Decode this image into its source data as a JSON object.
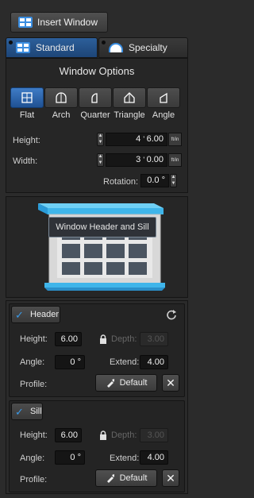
{
  "insert_window": {
    "label": "Insert Window",
    "icon": "window-icon"
  },
  "tabs": [
    {
      "label": "Standard",
      "icon": "window-icon",
      "active": true
    },
    {
      "label": "Specialty",
      "icon": "arch-window-icon",
      "active": false
    }
  ],
  "window_options": {
    "title": "Window Options",
    "shapes": [
      {
        "label": "Flat",
        "icon": "flat-window-icon",
        "active": true
      },
      {
        "label": "Arch",
        "icon": "arch-icon",
        "active": false
      },
      {
        "label": "Quarter",
        "icon": "quarter-icon",
        "active": false
      },
      {
        "label": "Triangle",
        "icon": "triangle-icon",
        "active": false
      },
      {
        "label": "Angle",
        "icon": "angle-icon",
        "active": false
      }
    ],
    "height": {
      "label": "Height:",
      "feet": "4",
      "inches": "6.00",
      "unit": "ft/in"
    },
    "width": {
      "label": "Width:",
      "feet": "3",
      "inches": "0.00",
      "unit": "ft/in"
    },
    "rotation": {
      "label": "Rotation:",
      "value": "0.0 °"
    }
  },
  "preview": {
    "tooltip": "Window Header and Sill"
  },
  "header": {
    "label": "Header",
    "checked": true,
    "height_label": "Height:",
    "height_value": "6.00",
    "depth_label": "Depth:",
    "depth_value": "3.00",
    "angle_label": "Angle:",
    "angle_value": "0 °",
    "extend_label": "Extend:",
    "extend_value": "4.00",
    "profile_label": "Profile:",
    "profile_button": "Default"
  },
  "sill": {
    "label": "Sill",
    "checked": true,
    "height_label": "Height:",
    "height_value": "6.00",
    "depth_label": "Depth:",
    "depth_value": "3.00",
    "angle_label": "Angle:",
    "angle_value": "0 °",
    "extend_label": "Extend:",
    "extend_value": "4.00",
    "profile_label": "Profile:",
    "profile_button": "Default"
  },
  "colors": {
    "accent": "#2d6cb8",
    "check": "#3a9ae8",
    "window_cap": "#3fb5ea"
  }
}
